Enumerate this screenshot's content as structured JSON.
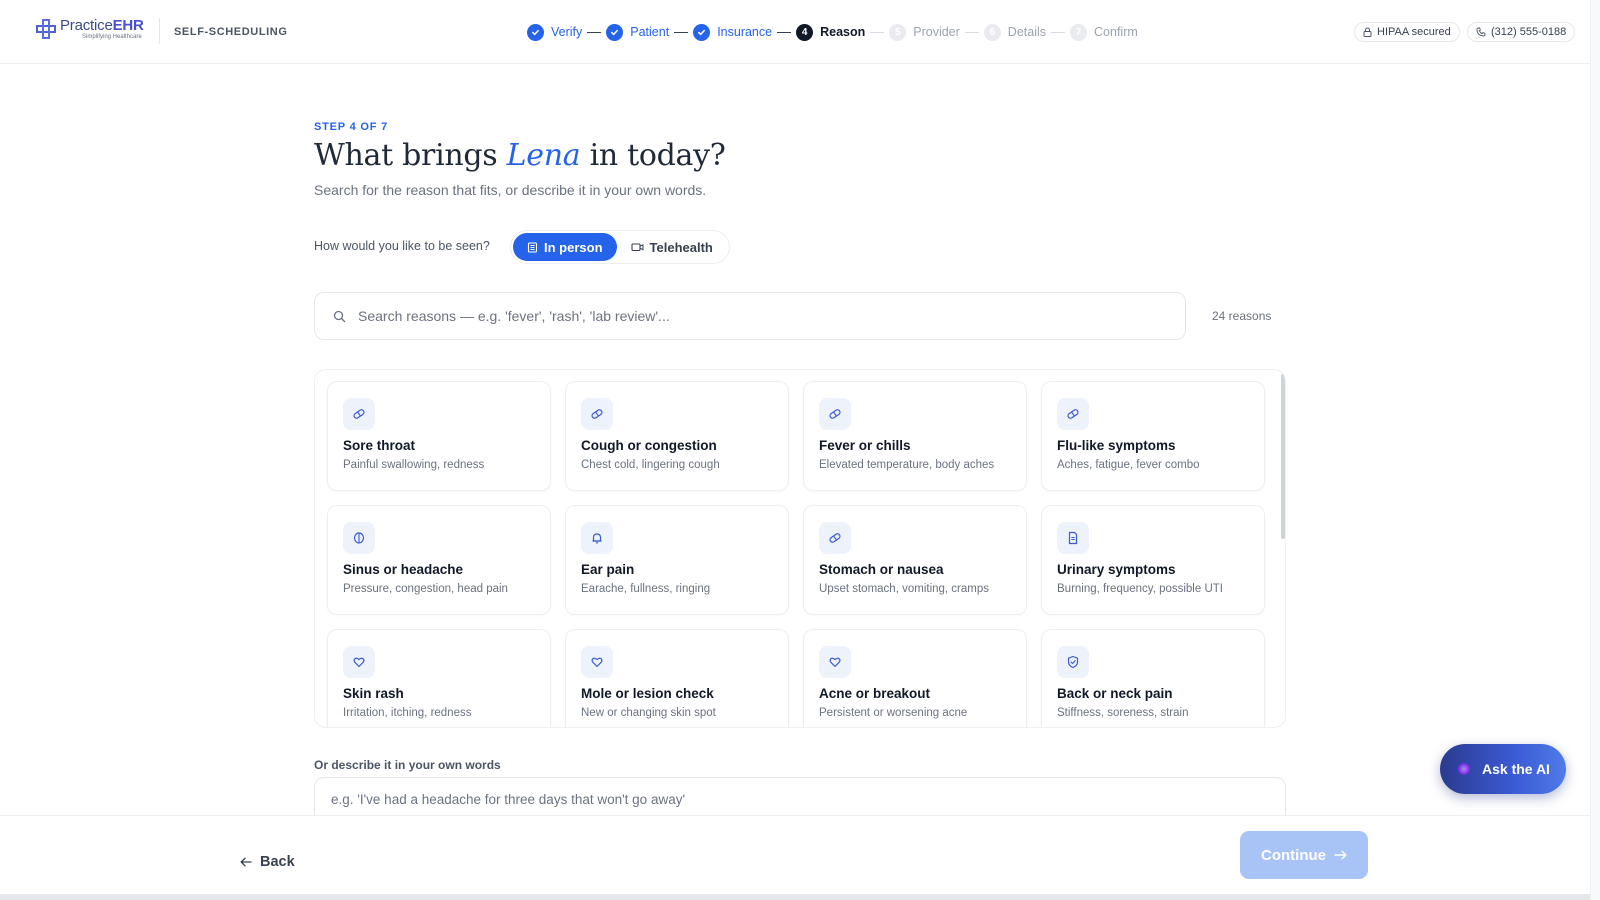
{
  "brand": {
    "name_part1": "Practice",
    "name_part2": "EHR",
    "tagline": "Simplifying Healthcare",
    "section": "SELF-SCHEDULING",
    "accent": "#2563eb"
  },
  "stepper": [
    {
      "number": "1",
      "label": "Verify",
      "state": "done"
    },
    {
      "number": "2",
      "label": "Patient",
      "state": "done"
    },
    {
      "number": "3",
      "label": "Insurance",
      "state": "done"
    },
    {
      "number": "4",
      "label": "Reason",
      "state": "current"
    },
    {
      "number": "5",
      "label": "Provider",
      "state": "todo"
    },
    {
      "number": "6",
      "label": "Details",
      "state": "todo"
    },
    {
      "number": "7",
      "label": "Confirm",
      "state": "todo"
    }
  ],
  "header_pills": {
    "hipaa": "HIPAA secured",
    "phone": "(312) 555-0188"
  },
  "page": {
    "eyebrow": "STEP 4 OF 7",
    "title_before": "What brings ",
    "title_name": "Lena",
    "title_after": " in today?",
    "subtitle": "Search for the reason that fits, or describe it in your own words."
  },
  "visit_type": {
    "question": "How would you like to be seen?",
    "options": [
      {
        "label": "In person",
        "selected": true,
        "icon": "building-icon"
      },
      {
        "label": "Telehealth",
        "selected": false,
        "icon": "video-icon"
      }
    ]
  },
  "search": {
    "placeholder": "Search reasons — e.g. 'fever', 'rash', 'lab review'...",
    "count": "24 reasons"
  },
  "reasons": [
    {
      "name": "Sore throat",
      "desc": "Painful swallowing, redness",
      "icon": "pill-icon"
    },
    {
      "name": "Cough or congestion",
      "desc": "Chest cold, lingering cough",
      "icon": "pill-icon"
    },
    {
      "name": "Fever or chills",
      "desc": "Elevated temperature, body aches",
      "icon": "pill-icon"
    },
    {
      "name": "Flu-like symptoms",
      "desc": "Aches, fatigue, fever combo",
      "icon": "pill-icon"
    },
    {
      "name": "Sinus or headache",
      "desc": "Pressure, congestion, head pain",
      "icon": "brain-icon"
    },
    {
      "name": "Ear pain",
      "desc": "Earache, fullness, ringing",
      "icon": "bell-icon"
    },
    {
      "name": "Stomach or nausea",
      "desc": "Upset stomach, vomiting, cramps",
      "icon": "pill-icon"
    },
    {
      "name": "Urinary symptoms",
      "desc": "Burning, frequency, possible UTI",
      "icon": "document-icon"
    },
    {
      "name": "Skin rash",
      "desc": "Irritation, itching, redness",
      "icon": "heart-icon"
    },
    {
      "name": "Mole or lesion check",
      "desc": "New or changing skin spot",
      "icon": "heart-icon"
    },
    {
      "name": "Acne or breakout",
      "desc": "Persistent or worsening acne",
      "icon": "heart-icon"
    },
    {
      "name": "Back or neck pain",
      "desc": "Stiffness, soreness, strain",
      "icon": "shield-icon"
    }
  ],
  "describe": {
    "label": "Or describe it in your own words",
    "placeholder": "e.g. 'I've had a headache for three days that won't go away'"
  },
  "ai_button": "Ask the AI",
  "footer": {
    "back": "Back",
    "continue": "Continue"
  }
}
